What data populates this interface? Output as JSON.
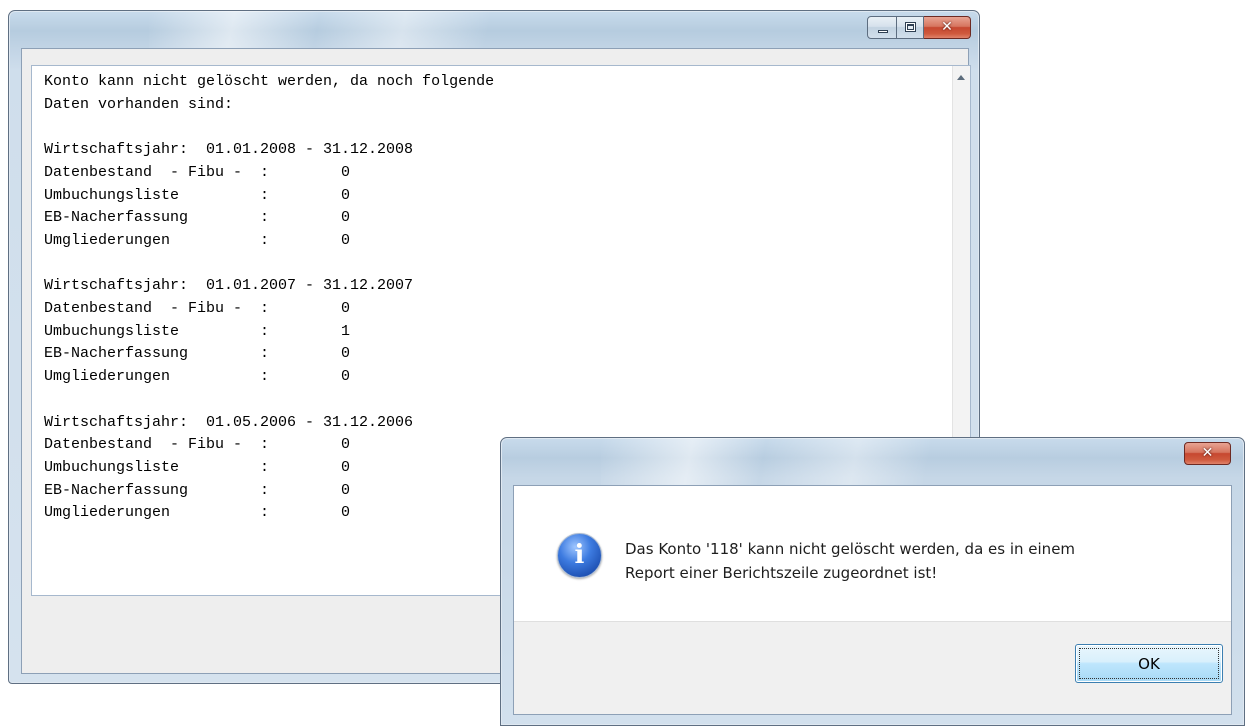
{
  "main_window": {
    "lines": [
      "Konto kann nicht gelöscht werden, da noch folgende",
      "Daten vorhanden sind:",
      "",
      "Wirtschaftsjahr:  01.01.2008 - 31.12.2008",
      "Datenbestand  - Fibu -  :        0",
      "Umbuchungsliste         :        0",
      "EB-Nacherfassung        :        0",
      "Umgliederungen          :        0",
      "",
      "Wirtschaftsjahr:  01.01.2007 - 31.12.2007",
      "Datenbestand  - Fibu -  :        0",
      "Umbuchungsliste         :        1",
      "EB-Nacherfassung        :        0",
      "Umgliederungen          :        0",
      "",
      "Wirtschaftsjahr:  01.05.2006 - 31.12.2006",
      "Datenbestand  - Fibu -  :        0",
      "Umbuchungsliste         :        0",
      "EB-Nacherfassung        :        0",
      "Umgliederungen          :        0"
    ]
  },
  "message_box": {
    "icon": "info-icon",
    "icon_glyph": "i",
    "text_line1": "Das Konto '118' kann nicht gelöscht werden, da es in einem",
    "text_line2": "Report einer Berichtszeile zugeordnet ist!",
    "ok_label": "OK"
  },
  "colors": {
    "close_button": "#c64730",
    "ok_button": "#bee6fd",
    "frame": "#c3d5e6"
  }
}
